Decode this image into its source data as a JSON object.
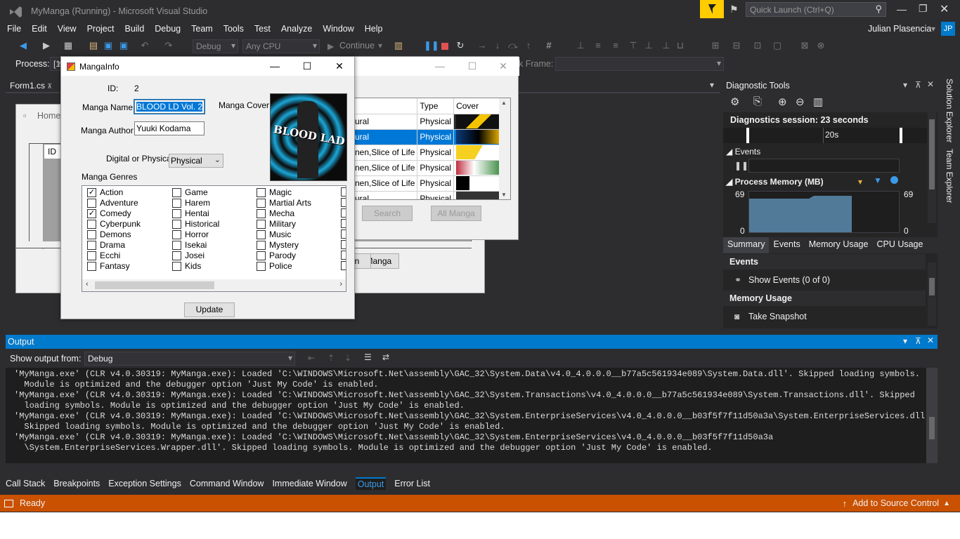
{
  "window": {
    "title": "MyManga (Running) - Microsoft Visual Studio",
    "quick_launch": "Quick Launch (Ctrl+Q)",
    "user": "Julian Plasencia",
    "user_initials": "JP"
  },
  "menu": [
    "File",
    "Edit",
    "View",
    "Project",
    "Build",
    "Debug",
    "Team",
    "Tools",
    "Test",
    "Analyze",
    "Window",
    "Help"
  ],
  "toolbar": {
    "config": "Debug",
    "platform": "Any CPU",
    "continue": "Continue"
  },
  "process_label": "Process:",
  "process_value": "[1",
  "stack_frame_label": "k Frame:",
  "editor_tab": "Form1.cs",
  "home": {
    "title": "Home",
    "id_header": "ID"
  },
  "manga_info": {
    "title": "MangaInfo",
    "id_label": "ID:",
    "id_value": "2",
    "name_label": "Manga Name:",
    "name_value": "BLOOD LD Vol. 2",
    "author_label": "Manga Author:",
    "author_value": "Yuuki Kodama",
    "cover_label": "Manga Cover:",
    "digital_label": "Digital or Physical:",
    "digital_value": "Physical",
    "genres_label": "Manga Genres",
    "update_button": "Update",
    "cover_text": "BLOOD LAD",
    "genres": [
      {
        "label": "Action",
        "checked": true
      },
      {
        "label": "Adventure",
        "checked": false
      },
      {
        "label": "Comedy",
        "checked": true
      },
      {
        "label": "Cyberpunk",
        "checked": false
      },
      {
        "label": "Demons",
        "checked": false
      },
      {
        "label": "Drama",
        "checked": false
      },
      {
        "label": "Ecchi",
        "checked": false
      },
      {
        "label": "Fantasy",
        "checked": false
      },
      {
        "label": "Game",
        "checked": false
      },
      {
        "label": "Harem",
        "checked": false
      },
      {
        "label": "Hentai",
        "checked": false
      },
      {
        "label": "Historical",
        "checked": false
      },
      {
        "label": "Horror",
        "checked": false
      },
      {
        "label": "Isekai",
        "checked": false
      },
      {
        "label": "Josei",
        "checked": false
      },
      {
        "label": "Kids",
        "checked": false
      },
      {
        "label": "Magic",
        "checked": false
      },
      {
        "label": "Martial Arts",
        "checked": false
      },
      {
        "label": "Mecha",
        "checked": false
      },
      {
        "label": "Military",
        "checked": false
      },
      {
        "label": "Music",
        "checked": false
      },
      {
        "label": "Mystery",
        "checked": false
      },
      {
        "label": "Parody",
        "checked": false
      },
      {
        "label": "Police",
        "checked": false
      }
    ]
  },
  "search_form": {
    "columns": [
      "Type",
      "Cover"
    ],
    "rows": [
      {
        "genre": "ural",
        "type": "Physical",
        "selected": false
      },
      {
        "genre": "ural",
        "type": "Physical",
        "selected": true
      },
      {
        "genre": "nen,Slice of Life",
        "type": "Physical",
        "selected": false
      },
      {
        "genre": "nen,Slice of Life",
        "type": "Physical",
        "selected": false
      },
      {
        "genre": "nen,Slice of Life",
        "type": "Physical",
        "selected": false
      },
      {
        "genre": "ural",
        "type": "Physical",
        "selected": false
      }
    ],
    "search_button": "Search",
    "all_button": "All Manga"
  },
  "home_buttons": {
    "left": "n",
    "all": "All Manga"
  },
  "diagnostics": {
    "title": "Diagnostic Tools",
    "session": "Diagnostics session: 23 seconds",
    "timeline_label": "20s",
    "events_section": "Events",
    "memory_section": "Process Memory (MB)",
    "mem_max": "69",
    "mem_min": "0",
    "tabs": [
      "Summary",
      "Events",
      "Memory Usage",
      "CPU Usage"
    ],
    "events_head": "Events",
    "show_events": "Show Events (0 of 0)",
    "memory_head": "Memory Usage",
    "take_snapshot": "Take Snapshot"
  },
  "side_tabs": [
    "Solution Explorer",
    "Team Explorer"
  ],
  "output": {
    "title": "Output",
    "show_from_label": "Show output from:",
    "source": "Debug",
    "lines": [
      "'MyManga.exe' (CLR v4.0.30319: MyManga.exe): Loaded 'C:\\WINDOWS\\Microsoft.Net\\assembly\\GAC_32\\System.Data\\v4.0_4.0.0.0__b77a5c561934e089\\System.Data.dll'. Skipped loading symbols.",
      "  Module is optimized and the debugger option 'Just My Code' is enabled.",
      "'MyManga.exe' (CLR v4.0.30319: MyManga.exe): Loaded 'C:\\WINDOWS\\Microsoft.Net\\assembly\\GAC_32\\System.Transactions\\v4.0_4.0.0.0__b77a5c561934e089\\System.Transactions.dll'. Skipped",
      "  loading symbols. Module is optimized and the debugger option 'Just My Code' is enabled.",
      "'MyManga.exe' (CLR v4.0.30319: MyManga.exe): Loaded 'C:\\WINDOWS\\Microsoft.Net\\assembly\\GAC_32\\System.EnterpriseServices\\v4.0_4.0.0.0__b03f5f7f11d50a3a\\System.EnterpriseServices.dll'.",
      "  Skipped loading symbols. Module is optimized and the debugger option 'Just My Code' is enabled.",
      "'MyManga.exe' (CLR v4.0.30319: MyManga.exe): Loaded 'C:\\WINDOWS\\Microsoft.Net\\assembly\\GAC_32\\System.EnterpriseServices\\v4.0_4.0.0.0__b03f5f7f11d50a3a",
      "  \\System.EnterpriseServices.Wrapper.dll'. Skipped loading symbols. Module is optimized and the debugger option 'Just My Code' is enabled."
    ]
  },
  "bottom_tabs": [
    "Call Stack",
    "Breakpoints",
    "Exception Settings",
    "Command Window",
    "Immediate Window",
    "Output",
    "Error List"
  ],
  "status": {
    "ready": "Ready",
    "source_control": "Add to Source Control"
  },
  "colors": {
    "accent": "#007acc",
    "status": "#ca5100",
    "bg": "#2d2d30"
  }
}
